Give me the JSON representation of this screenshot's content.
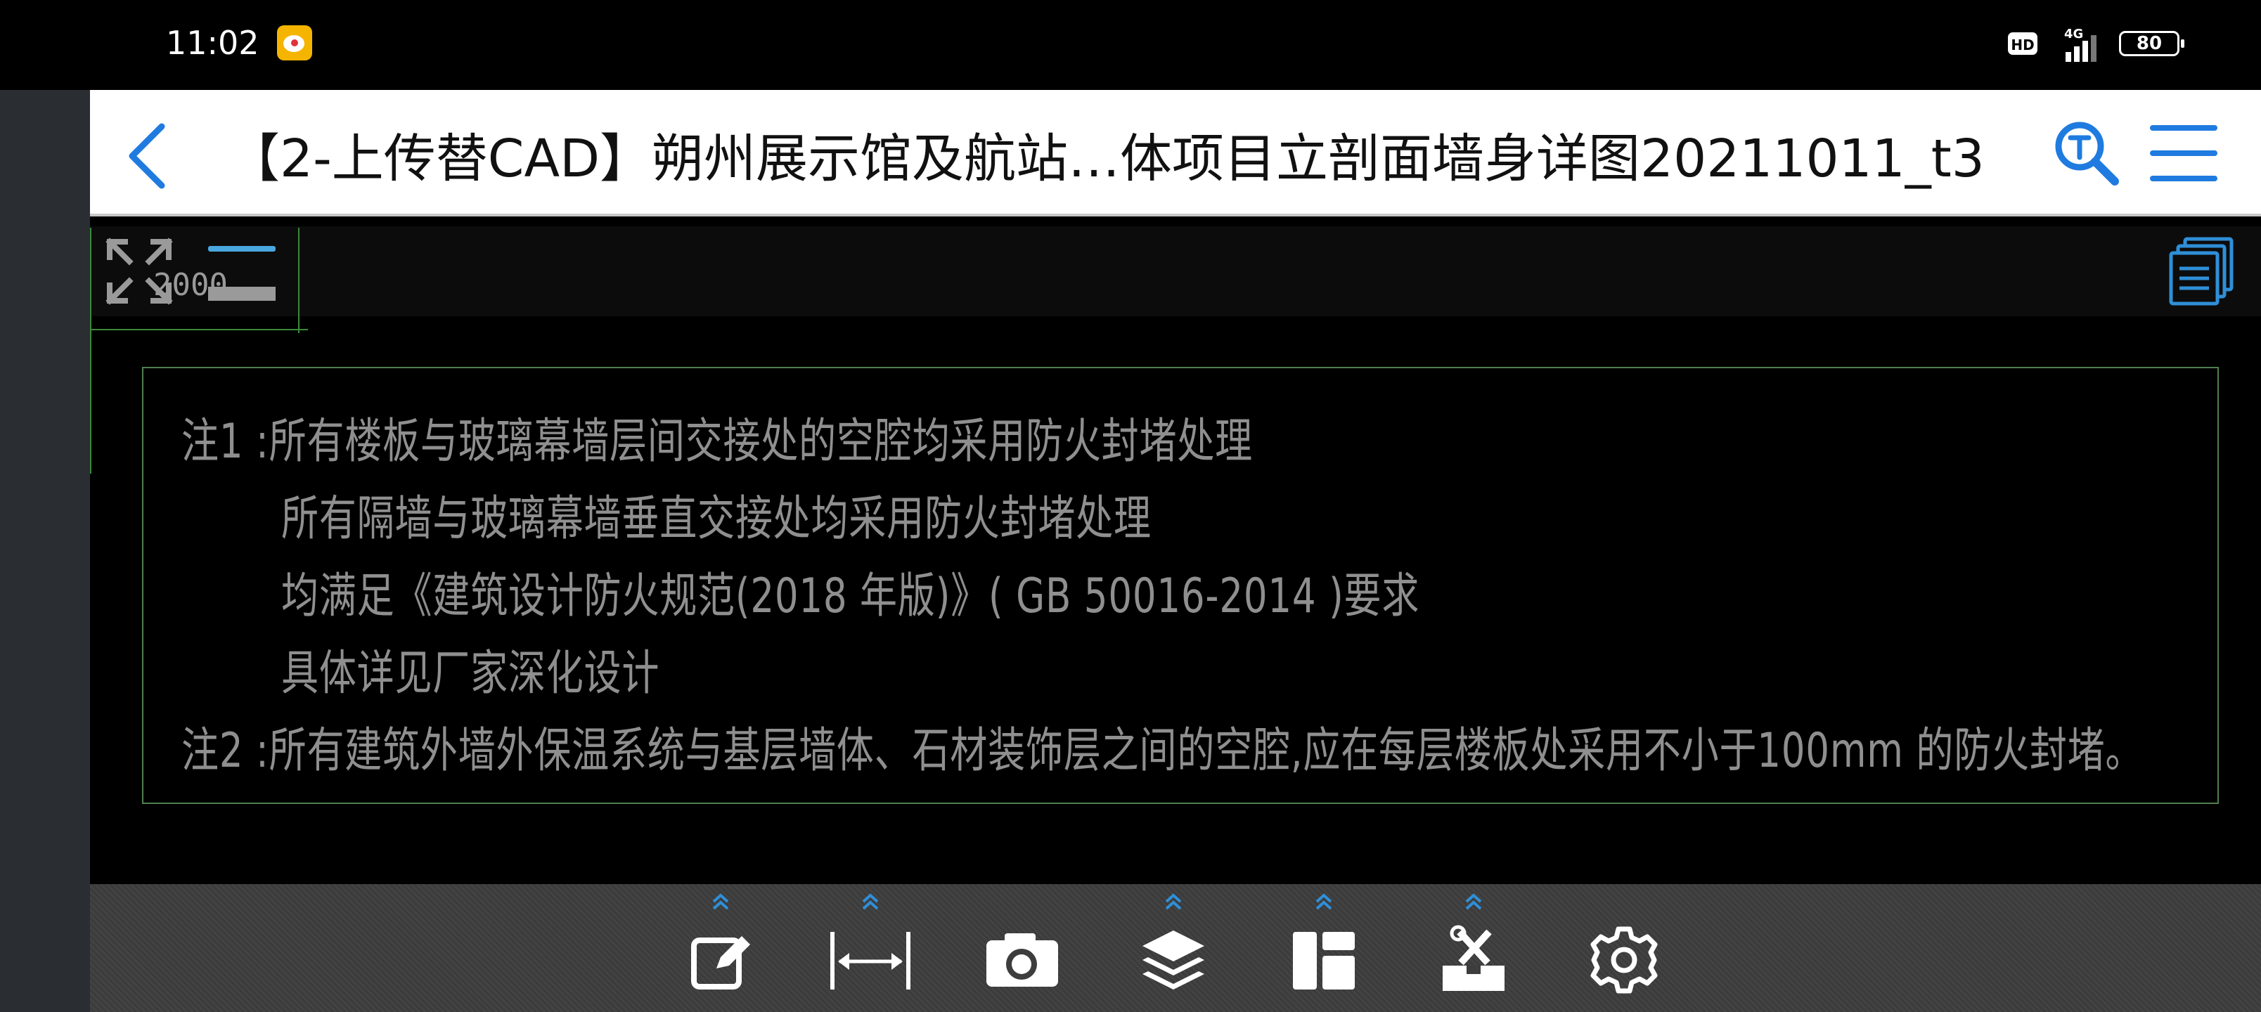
{
  "status_bar": {
    "time": "11:02",
    "network_label": "4G",
    "hd_label": "HD",
    "battery": "80",
    "icons": [
      "weibo-app-icon",
      "hd-icon",
      "signal-icon",
      "battery-icon"
    ]
  },
  "header": {
    "title": "【2-上传替CAD】朔州展示馆及航站…体项目立剖面墙身详图20211011_t3",
    "icons": [
      "back-chevron-icon",
      "text-search-icon",
      "hamburger-menu-icon"
    ],
    "accent_color": "#1f7be0"
  },
  "canvas": {
    "dimension_label": "2000",
    "notes": [
      "注1 :所有楼板与玻璃幕墙层间交接处的空腔均采用防火封堵处理",
      "所有隔墙与玻璃幕墙垂直交接处均采用防火封堵处理",
      "均满足《建筑设计防火规范(2018   年版)》( GB   50016-2014         )要求",
      "具体详见厂家深化设计",
      "注2 :所有建筑外墙外保温系统与基层墙体、石材装饰层之间的空腔,应在每层楼板处采用不小于100mm      的防火封堵。"
    ],
    "line_color": "#4f7f4f",
    "text_color": "#8f8f8f",
    "icons": [
      "fullscreen-toggle-icon",
      "zoom-out-icon",
      "document-list-icon"
    ]
  },
  "toolbar": {
    "tools": [
      {
        "name": "annotate",
        "icon": "edit-note-icon",
        "has_expand": true
      },
      {
        "name": "measure",
        "icon": "measure-distance-icon",
        "has_expand": true
      },
      {
        "name": "screenshot",
        "icon": "camera-icon",
        "has_expand": false
      },
      {
        "name": "layers",
        "icon": "layers-icon",
        "has_expand": true
      },
      {
        "name": "layout",
        "icon": "layout-icon",
        "has_expand": true
      },
      {
        "name": "tools",
        "icon": "toolbox-icon",
        "has_expand": true
      },
      {
        "name": "settings",
        "icon": "gear-icon",
        "has_expand": false
      }
    ],
    "chevron_color": "#2f8fd8"
  }
}
